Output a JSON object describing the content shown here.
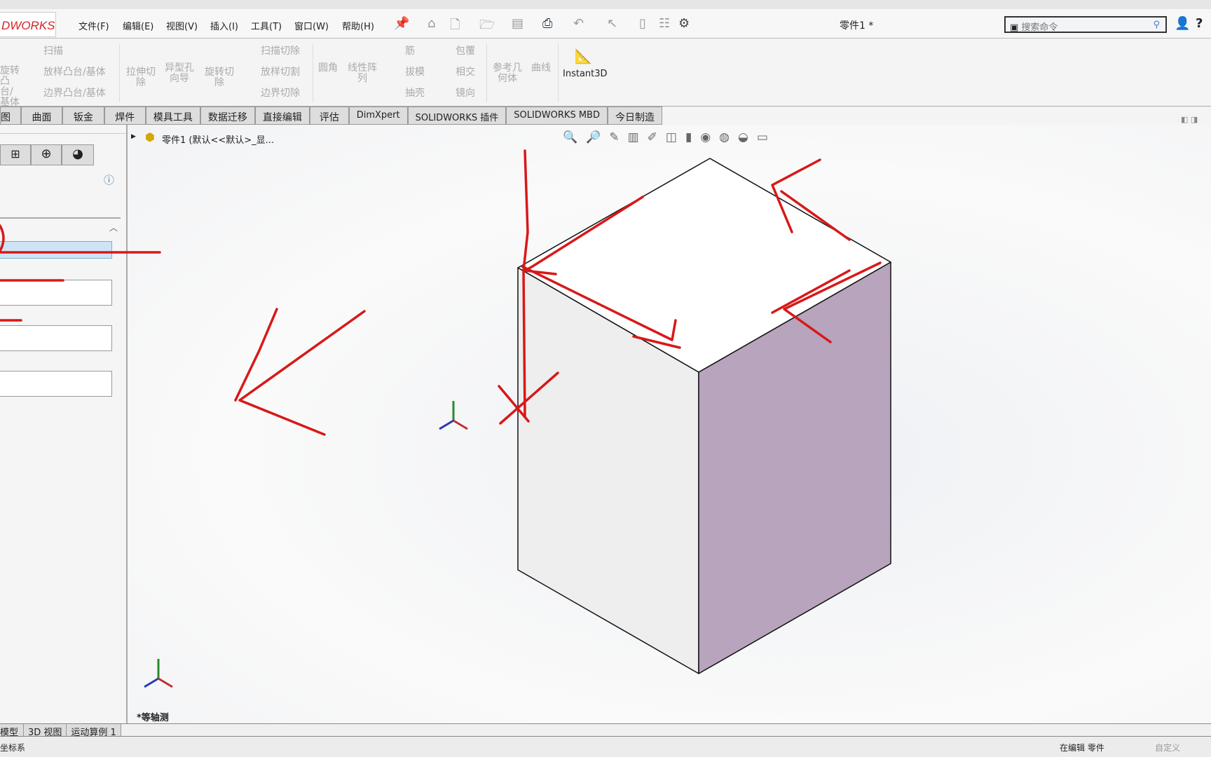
{
  "app": {
    "logo": "DWORKS",
    "title": "零件1 *",
    "search_placeholder": "搜索命令"
  },
  "menu": [
    "文件(F)",
    "编辑(E)",
    "视图(V)",
    "插入(I)",
    "工具(T)",
    "窗口(W)",
    "帮助(H)"
  ],
  "ribbon": {
    "sweep": "扫描",
    "loft": "放样凸台/基体",
    "boundary": "边界凸台/基体",
    "revolve": "旋转凸台/基体",
    "extrude_cut": "拉伸切除",
    "hole_wizard": "异型孔向导",
    "revolve_cut": "旋转切除",
    "sweep_cut": "扫描切除",
    "loft_cut": "放样切割",
    "boundary_cut": "边界切除",
    "fillet": "圆角",
    "linear_pattern": "线性阵列",
    "rib": "筋",
    "draft": "拔模",
    "shell": "抽壳",
    "wrap": "包覆",
    "intersect": "相交",
    "mirror": "镜向",
    "ref_geometry": "参考几何体",
    "curves": "曲线",
    "instant3d": "Instant3D"
  },
  "tabs": [
    "图",
    "曲面",
    "钣金",
    "焊件",
    "模具工具",
    "数据迁移",
    "直接编辑",
    "评估",
    "DimXpert",
    "SOLIDWORKS 插件",
    "SOLIDWORKS MBD",
    "今日制造"
  ],
  "tree": {
    "label": "零件1  (默认<<默认>_显..."
  },
  "view": {
    "orientation": "*等轴测"
  },
  "bottom_tabs": [
    "模型",
    "3D 视图",
    "运动算例 1"
  ],
  "status": {
    "left": "坐标系",
    "editing": "在编辑 零件",
    "custom": "自定义"
  },
  "colors": {
    "annotation": "#d81818",
    "side_face": "#b8a4bc",
    "front_face": "#eeeeee",
    "top_face": "#ffffff"
  }
}
